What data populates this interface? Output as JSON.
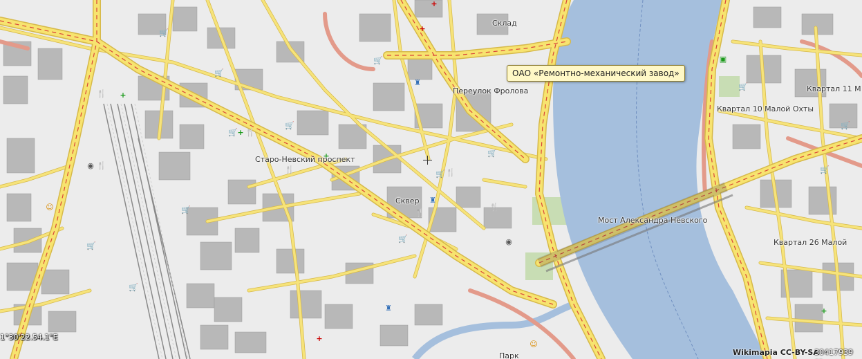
{
  "map": {
    "labels": {
      "sklad": "Склад",
      "pereulok_frolova": "Переулок Фролова",
      "kvartal_10": "Квартал 10 Малой Охты",
      "kvartal_11": "Квартал 11 М",
      "staro_nevsky": "Старо-Невский проспект",
      "skver": "Сквер",
      "most": "Мост Александра Невского",
      "kvartal_26": "Квартал 26 Малой",
      "park": "Парк"
    },
    "tooltip": "ОАО «Ремонтно-механический завод»",
    "coordinates": "1°30'22.54.1\"E",
    "attribution": "Wikimapia CC-BY-SA",
    "scale_text": "30417939 сс",
    "colors": {
      "background": "#ececec",
      "water": "#a5bfdd",
      "road_major": "#f7e36f",
      "road_casing": "#d6b94a",
      "road_center": "#d9453a",
      "road_minor": "#f6e37a",
      "building": "#b8b8b8",
      "rail": "#8a8a8a",
      "park": "#c8ddb4",
      "pink_road": "#e39a8a"
    },
    "icons": [
      "shopping-cart-icon",
      "restaurant-icon",
      "hospital-icon",
      "monument-icon",
      "cinema-icon"
    ]
  }
}
